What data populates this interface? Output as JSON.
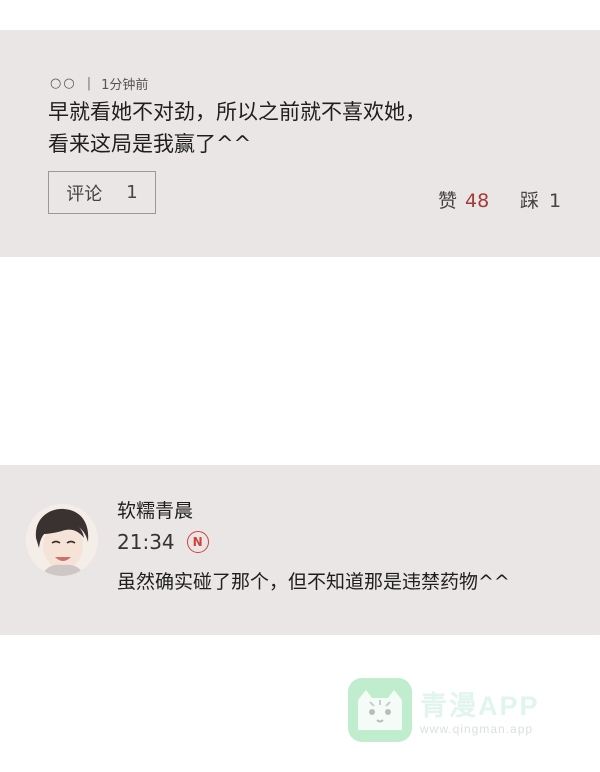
{
  "top_comment": {
    "user_masked": "○○",
    "separator": "|",
    "timestamp": "1分钟前",
    "text_lines": [
      "早就看她不对劲，所以之前就不喜欢她，",
      "看来这局是我赢了^^"
    ],
    "reply_label": "评论",
    "reply_count": "1",
    "like_label": "赞",
    "like_count": "48",
    "dislike_label": "踩",
    "dislike_count": "1"
  },
  "message": {
    "username": "软糯青晨",
    "time": "21:34",
    "badge": "N",
    "text": "虽然确实碰了那个，但不知道那是违禁药物^^"
  },
  "watermark": {
    "title": "青漫APP",
    "url": "www.qingman.app"
  },
  "colors": {
    "panel_bg": "#eae6e6",
    "like_count": "#a33a3a",
    "badge": "#d0433b"
  }
}
